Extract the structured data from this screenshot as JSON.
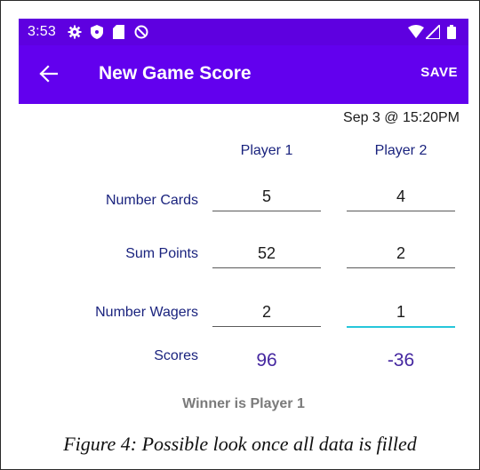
{
  "status_bar": {
    "time": "3:53",
    "icons": [
      "settings-icon",
      "shield-icon",
      "sd-card-icon",
      "at-sign-icon"
    ],
    "right_icons": [
      "wifi-icon",
      "signal-icon",
      "battery-icon"
    ]
  },
  "app_bar": {
    "title": "New Game Score",
    "save_label": "SAVE",
    "back_icon": "arrow-left-icon",
    "color": "#6200ee"
  },
  "game": {
    "date": "Sep 3 @ 15:20PM",
    "players": [
      "Player 1",
      "Player 2"
    ],
    "rows": [
      {
        "label": "Number Cards",
        "values": [
          "5",
          "4"
        ]
      },
      {
        "label": "Sum Points",
        "values": [
          "52",
          "2"
        ]
      },
      {
        "label": "Number Wagers",
        "values": [
          "2",
          "1"
        ]
      }
    ],
    "scores_label": "Scores",
    "scores": [
      "96",
      "-36"
    ],
    "winner": "Winner is Player 1"
  },
  "caption": "Figure 4: Possible look once all data is filled"
}
